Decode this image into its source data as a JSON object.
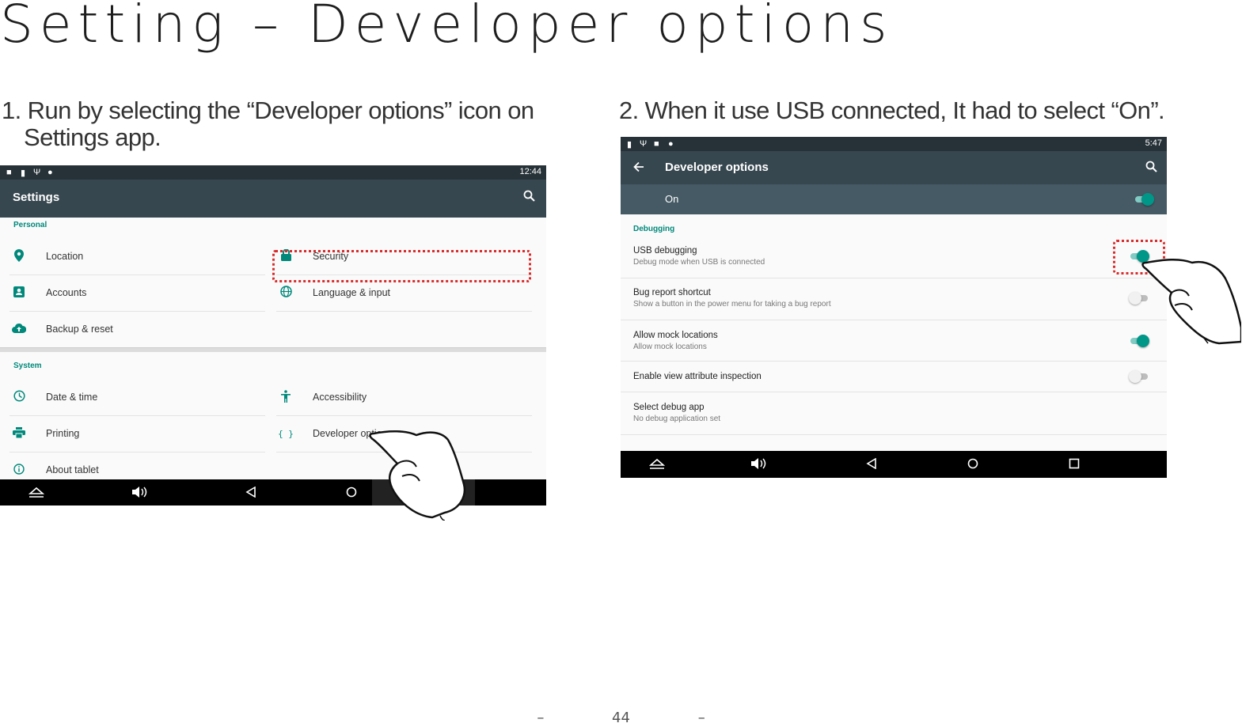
{
  "page": {
    "title": "Setting – Developer options",
    "step1_line1": "1. Run by selecting the “Developer options” icon on",
    "step1_line2": "Settings app.",
    "step2": "2. When it use USB connected, It had to select “On”.",
    "footer": {
      "dash_left": "–",
      "page_number": "44",
      "dash_right": "–"
    }
  },
  "screen1": {
    "status_time": "12:44",
    "app_title": "Settings",
    "personal_header": "Personal",
    "personal_items": [
      {
        "label": "Location",
        "icon": "location-pin-icon"
      },
      {
        "label": "Security",
        "icon": "lock-icon"
      },
      {
        "label": "Accounts",
        "icon": "account-icon"
      },
      {
        "label": "Language & input",
        "icon": "globe-icon"
      },
      {
        "label": "Backup & reset",
        "icon": "cloud-upload-icon"
      }
    ],
    "system_header": "System",
    "system_items": [
      {
        "label": "Date & time",
        "icon": "clock-icon"
      },
      {
        "label": "Accessibility",
        "icon": "accessibility-icon"
      },
      {
        "label": "Printing",
        "icon": "printer-icon"
      },
      {
        "label": "Developer options",
        "icon": "braces-icon"
      },
      {
        "label": "About tablet",
        "icon": "info-icon"
      }
    ]
  },
  "screen2": {
    "status_time": "5:47",
    "app_title": "Developer options",
    "on_label": "On",
    "debugging_header": "Debugging",
    "rows": [
      {
        "title": "USB debugging",
        "subtitle": "Debug mode when USB is connected",
        "state": "on"
      },
      {
        "title": "Bug report shortcut",
        "subtitle": "Show a button in the power menu for taking a bug report",
        "state": "off"
      },
      {
        "title": "Allow mock locations",
        "subtitle": "Allow mock locations",
        "state": "on"
      },
      {
        "title": "Enable view attribute inspection",
        "subtitle": "",
        "state": "off"
      },
      {
        "title": "Select debug app",
        "subtitle": "No debug application set",
        "state": "none"
      }
    ]
  },
  "colors": {
    "accent": "#00897b",
    "toolbar": "#37474f",
    "status_bar": "#263238",
    "highlight": "#d92b2b"
  }
}
